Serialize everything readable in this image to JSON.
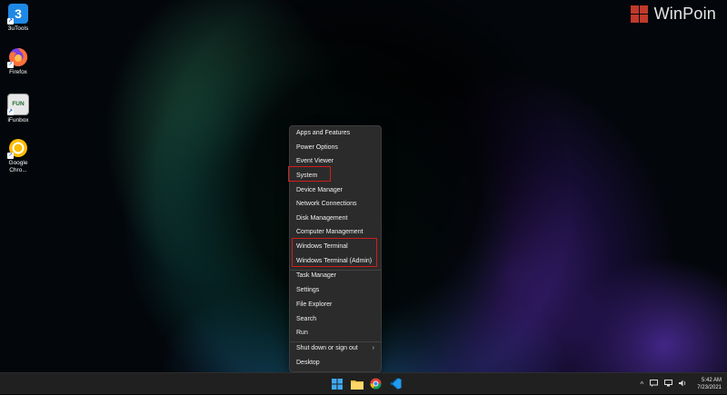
{
  "desktop": {
    "icons": [
      {
        "label": "3uTools",
        "glyph_text": "3",
        "color": "#1e88e5"
      },
      {
        "label": "Firefox",
        "color": "#ff7139"
      },
      {
        "label": "iFunbox",
        "glyph_text": "FUN",
        "color": "#e8e8e8"
      },
      {
        "label": "Google Chro...",
        "color": "#fbbc04"
      }
    ]
  },
  "brand": {
    "text": "WinPoin",
    "logo_color": "#c0392b"
  },
  "context_menu": {
    "items": [
      {
        "label": "Apps and Features"
      },
      {
        "label": "Power Options"
      },
      {
        "label": "Event Viewer"
      },
      {
        "label": "System"
      },
      {
        "label": "Device Manager"
      },
      {
        "label": "Network Connections"
      },
      {
        "label": "Disk Management"
      },
      {
        "label": "Computer Management"
      },
      {
        "label": "Windows Terminal"
      },
      {
        "label": "Windows Terminal (Admin)"
      },
      {
        "label": "Task Manager"
      },
      {
        "label": "Settings"
      },
      {
        "label": "File Explorer"
      },
      {
        "label": "Search"
      },
      {
        "label": "Run"
      },
      {
        "label": "Shut down or sign out",
        "submenu_arrow": "›"
      },
      {
        "label": "Desktop"
      }
    ],
    "highlight_color": "#d01d1d"
  },
  "taskbar": {
    "apps": [
      "start-icon",
      "file-explorer-icon",
      "chrome-icon",
      "vscode-icon"
    ],
    "tray": {
      "chevron": "^",
      "clock_time": "5:42 AM",
      "clock_date": "7/23/2021"
    }
  }
}
